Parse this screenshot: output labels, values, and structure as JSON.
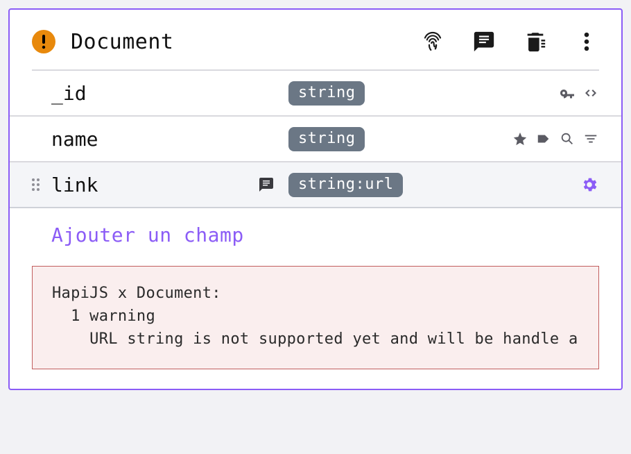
{
  "header": {
    "title": "Document"
  },
  "fields": [
    {
      "name": "_id",
      "type": "string",
      "selected": false,
      "icons": [
        "key",
        "code"
      ]
    },
    {
      "name": "name",
      "type": "string",
      "selected": false,
      "icons": [
        "star",
        "tag",
        "search",
        "filter"
      ]
    },
    {
      "name": "link",
      "type": "string:url",
      "selected": true,
      "icons": [
        "gear"
      ]
    }
  ],
  "actions": {
    "add_field": "Ajouter un champ"
  },
  "warning": {
    "title": "HapiJS x Document:",
    "count_line": "  1 warning",
    "message": "    URL string is not supported yet and will be handle a"
  }
}
